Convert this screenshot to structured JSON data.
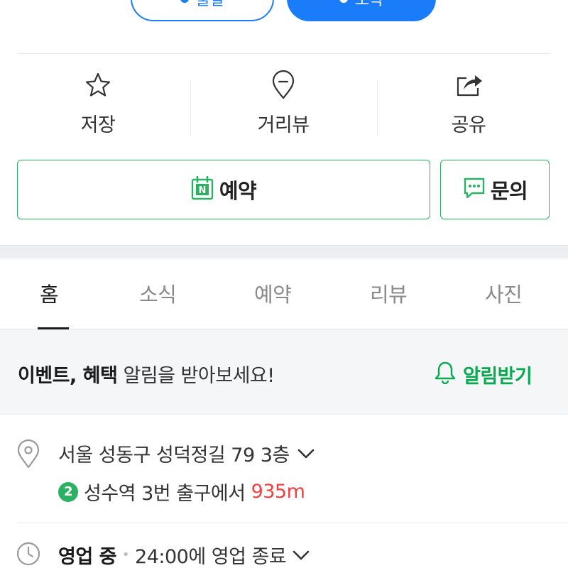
{
  "top_buttons": {
    "outline_label": "출발",
    "filled_label": "도착"
  },
  "actions": {
    "save_label": "저장",
    "street_label": "거리뷰",
    "share_label": "공유"
  },
  "booking": {
    "reserve_label": "예약",
    "reserve_badge": "N",
    "inquiry_label": "문의"
  },
  "tabs": [
    {
      "label": "홈",
      "active": true
    },
    {
      "label": "소식",
      "active": false
    },
    {
      "label": "예약",
      "active": false
    },
    {
      "label": "리뷰",
      "active": false
    },
    {
      "label": "사진",
      "active": false
    }
  ],
  "banner": {
    "bold": "이벤트, 혜택",
    "rest": " 알림을 받아보세요!",
    "button_label": "알림받기"
  },
  "info": {
    "address": "서울 성동구 성덕정길 79 3층",
    "subway_line": "2",
    "subway_text": "성수역 3번 출구에서",
    "distance": "935m",
    "hours_status": "영업 중",
    "hours_detail": "24:00에 영업 종료"
  },
  "colors": {
    "primary_blue": "#1a7cf8",
    "naver_green": "#2ab262",
    "alert_green": "#09aa4f",
    "distance_red": "#f04040"
  },
  "icons": [
    "star-icon",
    "map-pin-icon",
    "share-icon",
    "calendar-n-icon",
    "chat-icon",
    "bell-icon",
    "location-icon",
    "chevron-down-icon",
    "clock-icon"
  ]
}
